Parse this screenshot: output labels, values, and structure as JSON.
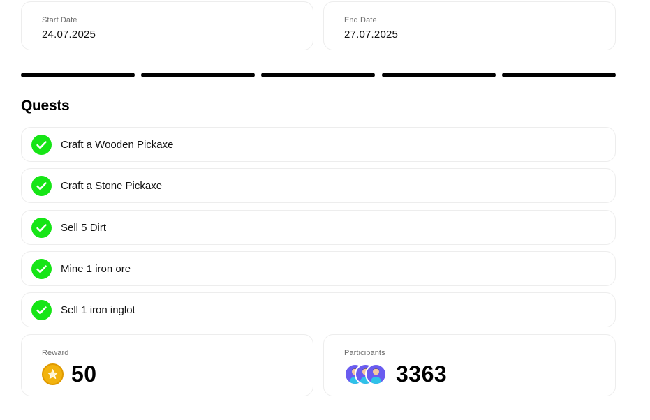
{
  "dates": {
    "start_label": "Start Date",
    "start_value": "24.07.2025",
    "end_label": "End Date",
    "end_value": "27.07.2025"
  },
  "progress": {
    "segments_total": 5,
    "segments_filled": 5
  },
  "quests": {
    "title": "Quests",
    "items": [
      {
        "label": "Craft a Wooden Pickaxe",
        "status": "completed"
      },
      {
        "label": "Craft a Stone Pickaxe",
        "status": "completed"
      },
      {
        "label": "Sell 5 Dirt",
        "status": "completed"
      },
      {
        "label": "Mine 1 iron ore",
        "status": "completed"
      },
      {
        "label": "Sell 1 iron inglot",
        "status": "completed"
      }
    ]
  },
  "reward": {
    "label": "Reward",
    "value": "50",
    "icon": "star-coin-icon"
  },
  "participants": {
    "label": "Participants",
    "value": "3363",
    "avatar_count": 3
  },
  "colors": {
    "check_green": "#16e516",
    "coin_gold": "#f2b30f",
    "avatar_purple": "#6a5cf0",
    "progress_fill": "#000000"
  }
}
